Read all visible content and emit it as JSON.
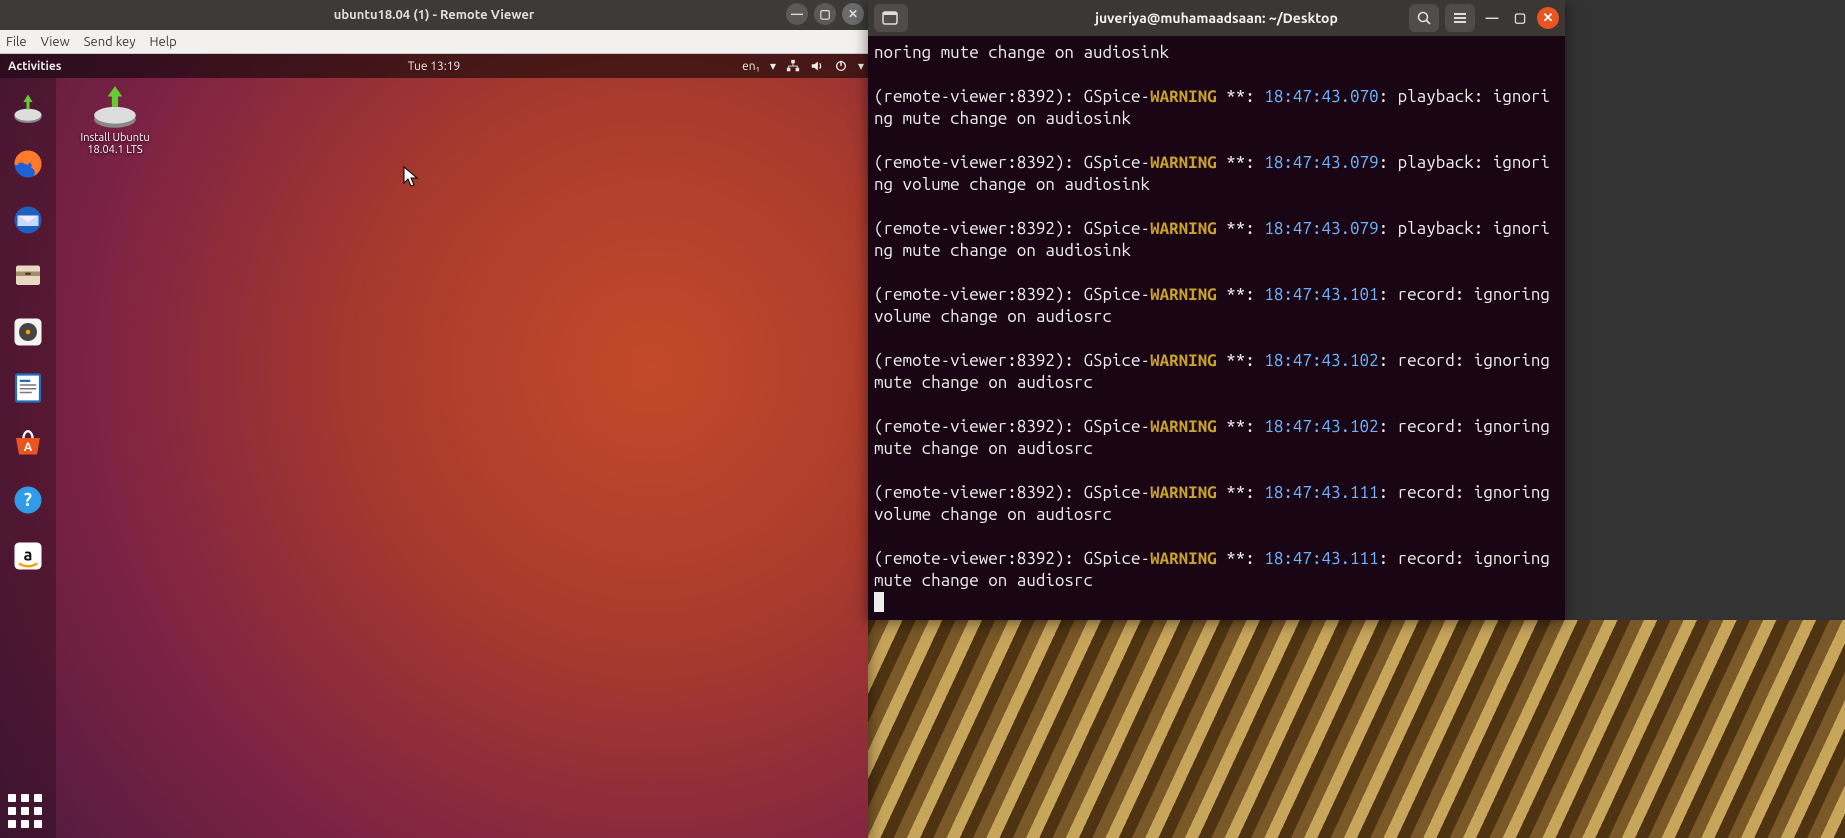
{
  "remote_viewer": {
    "title": "ubuntu18.04 (1) - Remote Viewer",
    "menu": {
      "file": "File",
      "view": "View",
      "sendkey": "Send key",
      "help": "Help"
    },
    "controls": {
      "min": "—",
      "max": "▢",
      "close": "✕"
    }
  },
  "guest": {
    "activities": "Activities",
    "clock": "Tue 13:19",
    "input_indicator": "en₁",
    "desktop_icon_label": "Install Ubuntu 18.04.1 LTS",
    "dock": {
      "firefox": "firefox",
      "thunderbird": "thunderbird",
      "files": "files",
      "rhythmbox": "rhythmbox",
      "writer": "writer",
      "software": "software",
      "help": "help",
      "amazon": "amazon"
    }
  },
  "terminal": {
    "title": "juveriya@muhamaadsaan: ~/Desktop",
    "process": "(remote-viewer:8392)",
    "component": "GSpice-",
    "warning_token": "WARNING",
    "sep": " **: ",
    "first_tail": "noring mute change on audiosink",
    "lines": [
      {
        "ts": "18:47:43.070",
        "tail": ": playback: ignoring mute change on audiosink"
      },
      {
        "ts": "18:47:43.079",
        "tail": ": playback: ignoring volume change on audiosink"
      },
      {
        "ts": "18:47:43.079",
        "tail": ": playback: ignoring mute change on audiosink"
      },
      {
        "ts": "18:47:43.101",
        "tail": ": record: ignoring volume change on audiosrc"
      },
      {
        "ts": "18:47:43.102",
        "tail": ": record: ignoring mute change on audiosrc"
      },
      {
        "ts": "18:47:43.102",
        "tail": ": record: ignoring mute change on audiosrc"
      },
      {
        "ts": "18:47:43.111",
        "tail": ": record: ignoring volume change on audiosrc"
      },
      {
        "ts": "18:47:43.111",
        "tail": ": record: ignoring mute change on audiosrc"
      }
    ]
  }
}
